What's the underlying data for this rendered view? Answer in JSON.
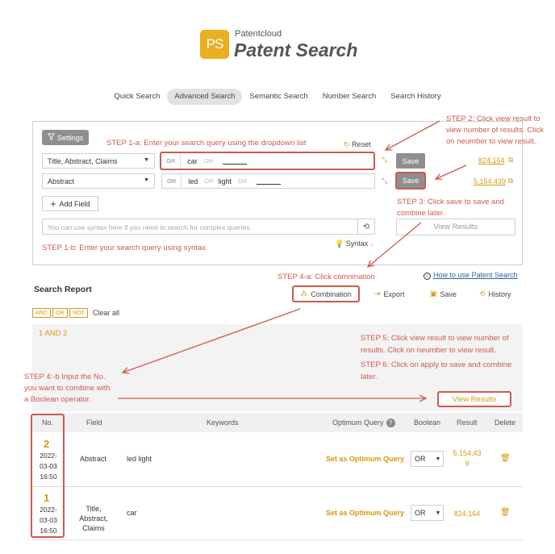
{
  "header": {
    "logo_text": "PS",
    "brand_small": "Patentcloud",
    "brand_big": "Patent Search"
  },
  "tabs": [
    {
      "label": "Quick Search"
    },
    {
      "label": "Advanced Search",
      "active": true
    },
    {
      "label": "Semantic Search"
    },
    {
      "label": "Number Search"
    },
    {
      "label": "Search History"
    }
  ],
  "search": {
    "settings_label": "Settings",
    "reset_label": "Reset",
    "rows": [
      {
        "field": "Title, Abstract, Claims",
        "or_tag": "OR",
        "terms": [
          "car"
        ],
        "or_soft": "OR",
        "save": "Save",
        "count": "824,164"
      },
      {
        "field": "Abstract",
        "or_tag": "OR",
        "terms": [
          "led",
          "light"
        ],
        "or_soft": "OR",
        "save": "Save",
        "count": "5,154,439"
      }
    ],
    "add_field": "Add Field",
    "syntax_placeholder": "You can use syntax here if you need to search for complex queries.",
    "syntax_label": "Syntax",
    "view_results": "View Results"
  },
  "steps": {
    "s1a_key": "STEP 1-a",
    "s1a_text": ": Enter your search query using the dropdown list",
    "s1b_key": "STEP 1-b",
    "s1b_text": ": Enter your search query using syntax",
    "s2_key": "STEP 2",
    "s2_line1": ": Click view result to",
    "s2_line2": "view number of results. Click",
    "s2_line3": "on neumber to view result.",
    "s3_key": "STEP 3",
    "s3_line1": ": Click save to save and",
    "s3_line2": "combine later.",
    "s4a_key": "STEP 4-a",
    "s4a_text": ": Click comnination",
    "s4b_key": "STEP 4:-b",
    "s4b_line1": " Input the No.",
    "s4b_line2": "you want to combine with",
    "s4b_line3": "a Boolean operator.",
    "s5_key": "STEP 5",
    "s5_line1": ": Click view result to view number of",
    "s5_line2": "results. Click on neumber to view result.",
    "s6_key": "STEP 6",
    "s6_line1": ": Click on apply to save and combine",
    "s6_line2": "later."
  },
  "report": {
    "title": "Search Report",
    "how_link": "How to use Patent Search",
    "combination": "Combination",
    "export": "Export",
    "save": "Save",
    "history": "History",
    "bool_ops": [
      "AND",
      "OR",
      "NOT"
    ],
    "clear_all": "Clear all",
    "combine_expr": "1 AND 2",
    "view_results": "View Results"
  },
  "table": {
    "headers": {
      "no": "No.",
      "field": "Field",
      "keywords": "Keywords",
      "optimum": "Optimum Query",
      "boolean": "Boolean",
      "result": "Result",
      "delete": "Delete"
    },
    "rows": [
      {
        "no": "2",
        "date1": "2022-",
        "date2": "03-03",
        "time": "16:50",
        "field": "Abstract",
        "keywords": "led light",
        "optimum": "Set as Optimum Query",
        "boolean": "OR",
        "result1": "5,154,43",
        "result2": "9"
      },
      {
        "no": "1",
        "date1": "2022-",
        "date2": "03-03",
        "time": "16:50",
        "field1": "Title, Abstract,",
        "field2": "Claims",
        "keywords": "car",
        "optimum": "Set as Optimum Query",
        "boolean": "OR",
        "result1": "824,164"
      }
    ]
  },
  "colors": {
    "accent": "#d49a10",
    "annotation": "#cc5a4f",
    "logo": "#e8b021"
  }
}
